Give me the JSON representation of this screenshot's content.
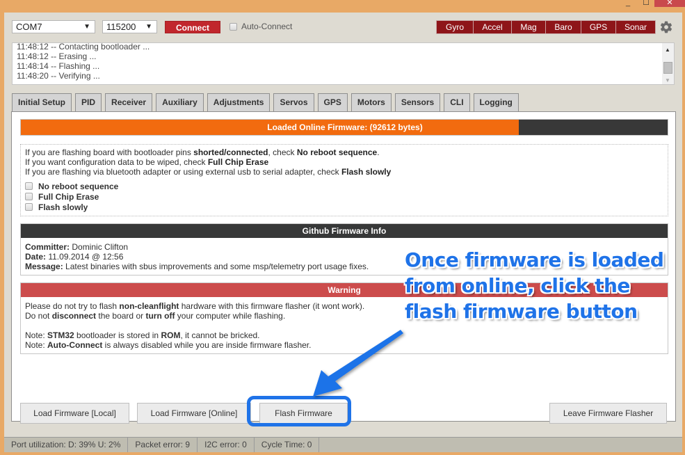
{
  "window": {
    "minimize": "_",
    "maximize": "☐",
    "close": "✕"
  },
  "header": {
    "port": "COM7",
    "baud": "115200",
    "connect_label": "Connect",
    "auto_connect_label": "Auto-Connect",
    "sensors": [
      "Gyro",
      "Accel",
      "Mag",
      "Baro",
      "GPS",
      "Sonar"
    ],
    "sensor_color": "#8e1519",
    "connect_color": "#c1272d"
  },
  "log": [
    "11:48:12 -- Contacting bootloader ...",
    "11:48:12 -- Erasing ...",
    "11:48:14 -- Flashing ...",
    "11:48:20 -- Verifying ..."
  ],
  "tabs": [
    "Initial Setup",
    "PID",
    "Receiver",
    "Auxiliary",
    "Adjustments",
    "Servos",
    "GPS",
    "Motors",
    "Sensors",
    "CLI",
    "Logging"
  ],
  "progress": {
    "label": "Loaded Online Firmware: (92612 bytes)",
    "percent": 77,
    "color": "#f26b0f"
  },
  "options": {
    "line1": {
      "pre": "If you are flashing board with bootloader pins ",
      "b1": "shorted/connected",
      "mid": ", check ",
      "b2": "No reboot sequence",
      "post": "."
    },
    "line2": {
      "pre": "If you want configuration data to be wiped, check ",
      "b1": "Full Chip Erase"
    },
    "line3": {
      "pre": "If you are flashing via bluetooth adapter or using external usb to serial adapter, check ",
      "b1": "Flash slowly"
    },
    "checkboxes": [
      "No reboot sequence",
      "Full Chip Erase",
      "Flash slowly"
    ]
  },
  "github": {
    "title": "Github Firmware Info",
    "committer_label": "Committer:",
    "committer": " Dominic Clifton",
    "date_label": "Date:",
    "date": " 11.09.2014 @ 12:56",
    "message_label": "Message:",
    "message": " Latest binaries with sbus improvements and some msp/telemetry port usage fixes."
  },
  "warning": {
    "title": "Warning",
    "l1_pre": "Please do not try to flash ",
    "l1_b": "non-cleanflight",
    "l1_post": " hardware with this firmware flasher (it wont work).",
    "l2_pre": "Do not ",
    "l2_b1": "disconnect",
    "l2_mid": " the board or ",
    "l2_b2": "turn off",
    "l2_post": " your computer while flashing.",
    "l3_pre": "Note: ",
    "l3_b1": "STM32",
    "l3_mid": " bootloader is stored in ",
    "l3_b2": "ROM",
    "l3_post": ", it cannot be bricked.",
    "l4_pre": "Note: ",
    "l4_b": "Auto-Connect",
    "l4_post": " is always disabled while you are inside firmware flasher."
  },
  "buttons": {
    "load_local": "Load Firmware [Local]",
    "load_online": "Load Firmware [Online]",
    "flash": "Flash Firmware",
    "leave": "Leave Firmware Flasher"
  },
  "status": {
    "port_util": "Port utilization: D: 39% U: 2%",
    "packet_error": "Packet error: 9",
    "i2c_error": "I2C error: 0",
    "cycle_time": "Cycle Time: 0"
  },
  "annotation": {
    "lines": [
      "Once firmware is loaded",
      "from online, click the",
      "flash firmware button"
    ],
    "color": "#1f73e8"
  }
}
